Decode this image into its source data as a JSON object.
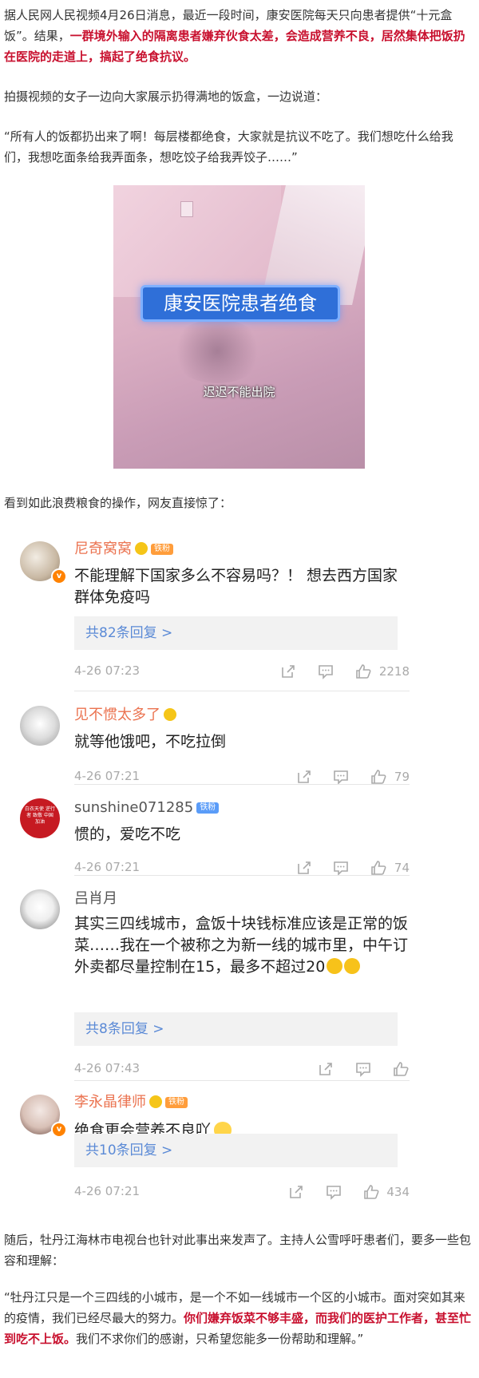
{
  "article": {
    "p1_plain": "据人民网人民视频4月26日消息，最近一段时间，康安医院每天只向患者提供“十元盒饭”。结果，",
    "p1_highlight": "一群境外输入的隔离患者嫌弃伙食太差，会造成营养不良，居然集体把饭扔在医院的走道上，搞起了绝食抗议。",
    "p2": "拍摄视频的女子一边向大家展示扔得满地的饭盒，一边说道：",
    "p3": "“所有人的饭都扔出来了啊！每层楼都绝食，大家就是抗议不吃了。我们想吃什么给我们，我想吃面条给我弄面条，想吃饺子给我弄饺子……”",
    "video": {
      "banner": "康安医院患者绝食",
      "subtitle": "迟迟不能出院"
    },
    "p4": "看到如此浪费粮食的操作，网友直接惊了：",
    "p5": "随后，牡丹江海林市电视台也针对此事出来发声了。主持人公雪呼吁患者们，要多一些包容和理解：",
    "p6_plain1": "“牡丹江只是一个三四线的小城市，是一个不如一线城市一个区的小城市。面对突如其来的疫情，我们已经尽最大的努力。",
    "p6_highlight": "你们嫌弃饭菜不够丰盛，而我们的医护工作者，甚至忙到吃不上饭。",
    "p6_plain2": "我们不求你们的感谢，只希望您能多一份帮助和理解。”"
  },
  "comments": [
    {
      "user": "尼奇窝窝",
      "badge": "铁粉",
      "text": "不能理解下国家多么不容易吗？！ 想去西方国家群体免疫吗",
      "replies": "共82条回复 >",
      "date": "4-26 07:23",
      "likes": "2218"
    },
    {
      "user": "见不惯太多了",
      "text": "就等他饿吧，不吃拉倒",
      "date": "4-26 07:21",
      "likes": "79"
    },
    {
      "user": "sunshine071285",
      "badge": "铁粉",
      "avatar_text": "白衣天使 逆行者 致敬 中国加油",
      "text": "惯的，爱吃不吃",
      "date": "4-26 07:21",
      "likes": "74"
    },
    {
      "user": "吕肖月",
      "text": "其实三四线城市，盒饭十块钱标准应该是正常的饭菜……我在一个被称之为新一线的城市里，中午订外卖都尽量控制在15，最多不超过20",
      "replies": "共8条回复 >",
      "date": "4-26 07:43",
      "likes": ""
    },
    {
      "user": "李永晶律师",
      "badge": "铁粉",
      "text": "绝食更会营养不良吖",
      "replies": "共10条回复 >",
      "date": "4-26 07:21",
      "likes": "434"
    }
  ],
  "colors": {
    "highlight": "#c8102e",
    "username": "#eb7350",
    "reply_link": "#5b8ad6",
    "meta_gray": "#aaaaaa"
  },
  "icons": [
    "share-icon",
    "comment-icon",
    "like-icon",
    "verified-badge-icon",
    "emoji-icon"
  ]
}
